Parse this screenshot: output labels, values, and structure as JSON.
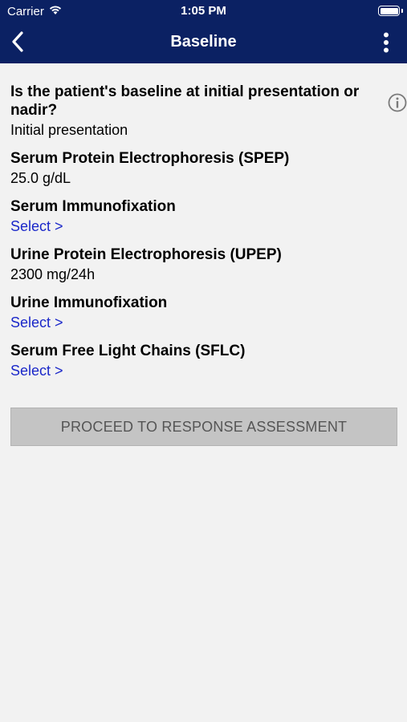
{
  "status_bar": {
    "carrier": "Carrier",
    "time": "1:05 PM",
    "wifi_icon": "wifi-icon",
    "battery_icon": "battery-icon"
  },
  "nav": {
    "title": "Baseline",
    "back_icon": "chevron-left-icon",
    "menu_icon": "more-vertical-icon"
  },
  "question": {
    "label": "Is the patient's baseline at initial presentation or nadir?",
    "value": "Initial presentation",
    "info_icon": "info-icon"
  },
  "fields": [
    {
      "label": "Serum Protein Electrophoresis (SPEP)",
      "value": "25.0 g/dL"
    },
    {
      "label": "Serum Immunofixation",
      "value": "Select >"
    },
    {
      "label": "Urine Protein Electrophoresis (UPEP)",
      "value": "2300 mg/24h"
    },
    {
      "label": "Urine Immunofixation",
      "value": "Select >"
    },
    {
      "label": "Serum Free Light Chains (SFLC)",
      "value": "Select >"
    }
  ],
  "proceed_button": "PROCEED TO RESPONSE ASSESSMENT",
  "colors": {
    "header_bg": "#0b2163",
    "link": "#1a27c9",
    "page_bg": "#f2f2f2",
    "button_bg": "#c4c4c4"
  }
}
